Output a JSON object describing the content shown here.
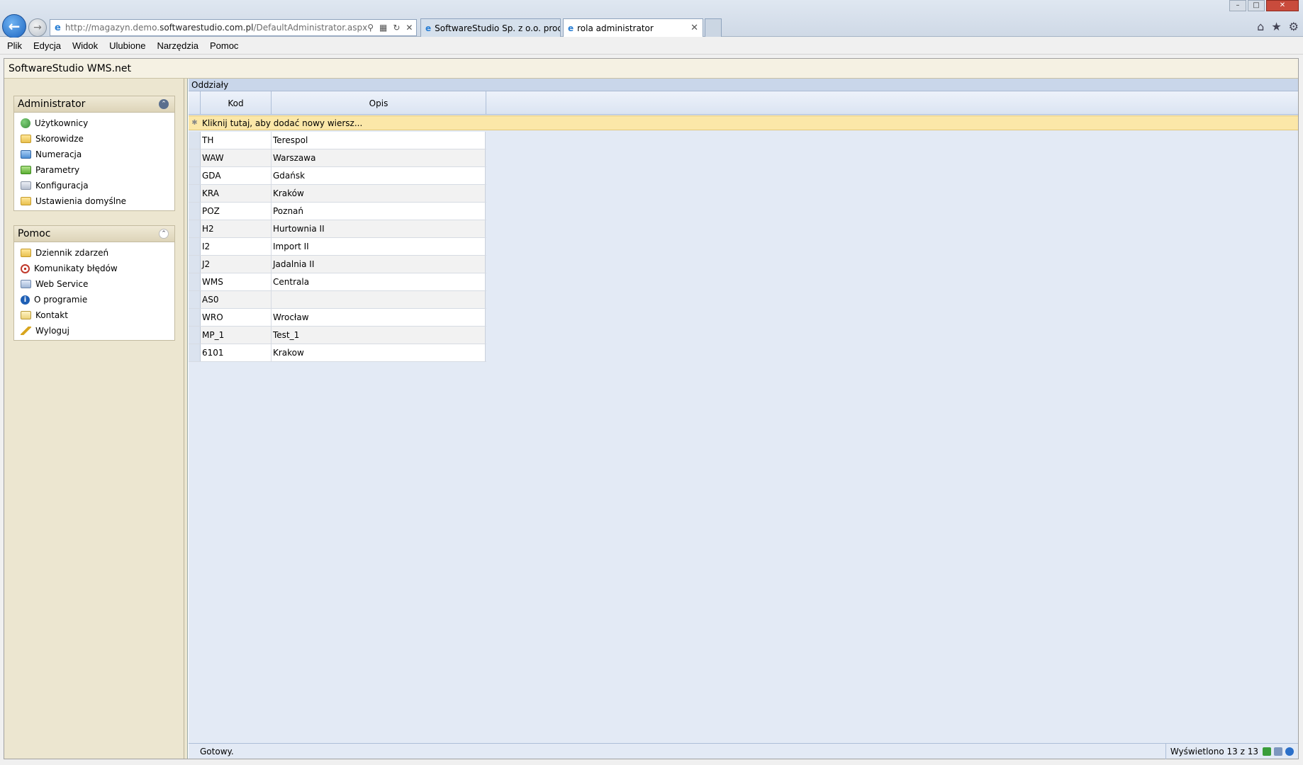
{
  "browser": {
    "url_prefix": "http://magazyn.demo.",
    "url_domain": "softwarestudio.com.pl",
    "url_path": "/DefaultAdministrator.aspx",
    "tabs": [
      {
        "label": "SoftwareStudio Sp. z o.o. prod..."
      },
      {
        "label": "rola administrator"
      }
    ]
  },
  "menubar": {
    "items": [
      "Plik",
      "Edycja",
      "Widok",
      "Ulubione",
      "Narzędzia",
      "Pomoc"
    ]
  },
  "app": {
    "title": "SoftwareStudio WMS.net"
  },
  "sidebar": {
    "admin_panel": {
      "title": "Administrator",
      "items": [
        {
          "label": "Użytkownicy",
          "icon": "users-icon"
        },
        {
          "label": "Skorowidze",
          "icon": "folder-icon"
        },
        {
          "label": "Numeracja",
          "icon": "folder-icon"
        },
        {
          "label": "Parametry",
          "icon": "folder-icon"
        },
        {
          "label": "Konfiguracja",
          "icon": "folder-icon"
        },
        {
          "label": "Ustawienia domyślne",
          "icon": "folder-icon"
        }
      ]
    },
    "help_panel": {
      "title": "Pomoc",
      "items": [
        {
          "label": "Dziennik zdarzeń",
          "icon": "log-icon"
        },
        {
          "label": "Komunikaty błędów",
          "icon": "error-icon"
        },
        {
          "label": "Web Service",
          "icon": "web-service-icon"
        },
        {
          "label": "O programie",
          "icon": "info-icon"
        },
        {
          "label": "Kontakt",
          "icon": "mail-icon"
        },
        {
          "label": "Wyloguj",
          "icon": "key-icon"
        }
      ]
    }
  },
  "grid": {
    "title": "Oddziały",
    "columns": [
      "Kod",
      "Opis"
    ],
    "new_row_text": "Kliknij tutaj, aby dodać nowy wiersz...",
    "rows": [
      {
        "kod": "TH",
        "opis": "Terespol"
      },
      {
        "kod": "WAW",
        "opis": "Warszawa"
      },
      {
        "kod": "GDA",
        "opis": "Gdańsk"
      },
      {
        "kod": "KRA",
        "opis": "Kraków"
      },
      {
        "kod": "POZ",
        "opis": "Poznań"
      },
      {
        "kod": "H2",
        "opis": "Hurtownia II"
      },
      {
        "kod": "I2",
        "opis": "Import II"
      },
      {
        "kod": "J2",
        "opis": "Jadalnia II"
      },
      {
        "kod": "WMS",
        "opis": "Centrala"
      },
      {
        "kod": "AS0",
        "opis": ""
      },
      {
        "kod": "WRO",
        "opis": "Wrocław"
      },
      {
        "kod": "MP_1",
        "opis": "Test_1"
      },
      {
        "kod": "6101",
        "opis": "Krakow"
      }
    ]
  },
  "status": {
    "ready": "Gotowy.",
    "count": "Wyświetlono 13 z 13"
  }
}
